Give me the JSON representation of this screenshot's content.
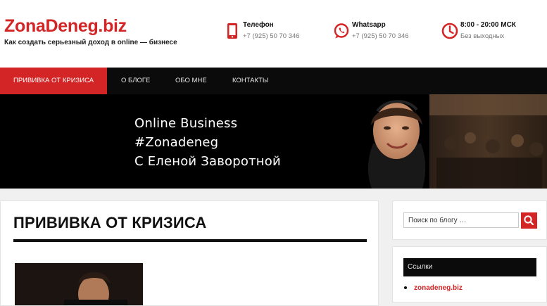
{
  "header": {
    "site_title": "ZonaDeneg.biz",
    "tagline": "Как создать серьезный доход в online — бизнесе",
    "contacts": [
      {
        "icon": "phone-icon",
        "label": "Телефон",
        "value": "+7 (925) 50 70 346"
      },
      {
        "icon": "whatsapp-icon",
        "label": "Whatsapp",
        "value": "+7 (925) 50 70 346"
      },
      {
        "icon": "clock-icon",
        "label": "8:00 - 20:00 МСК",
        "value": "Без выходных"
      }
    ]
  },
  "nav": {
    "items": [
      {
        "label": "ПРИВИВКА ОТ КРИЗИСА",
        "active": true
      },
      {
        "label": "О БЛОГЕ",
        "active": false
      },
      {
        "label": "ОБО МНЕ",
        "active": false
      },
      {
        "label": "КОНТАКТЫ",
        "active": false
      }
    ]
  },
  "hero": {
    "lines": [
      "Online Business",
      "#Zonadeneg",
      "С Еленой Заворотной"
    ]
  },
  "main": {
    "post_title": "ПРИВИВКА ОТ КРИЗИСА"
  },
  "sidebar": {
    "search": {
      "placeholder": "Поиск по блогу …"
    },
    "links_widget": {
      "title": "Ссылки",
      "items": [
        "zonadeneg.biz"
      ]
    }
  },
  "colors": {
    "accent": "#d32525",
    "dark": "#0b0b0b",
    "background": "#f0f0f0"
  }
}
